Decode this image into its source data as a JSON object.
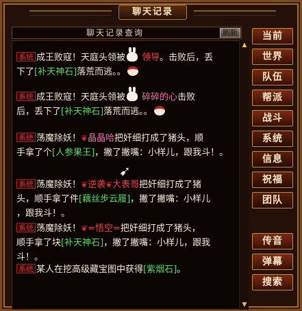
{
  "window": {
    "title": "聊天记录"
  },
  "query": {
    "label": "聊天记录查询",
    "refresh_label": "刷新"
  },
  "side_buttons": [
    "当前",
    "世界",
    "队伍",
    "帮派",
    "战斗",
    "系统",
    "信息",
    "祝福",
    "团队",
    "传音",
    "弹幕",
    "搜索"
  ],
  "messages": [
    {
      "tag": "系统",
      "line1a": "成王败寇！天庭头领被",
      "name": "领导",
      "line1b": "。击败后，丢",
      "line2a": "下了",
      "item": "[补天神石]",
      "line2b": "落荒而逃。。"
    },
    {
      "tag": "系统",
      "line1a": "成王败寇！天庭头领被",
      "name": "碎碎的心",
      "line1b": "击败",
      "line2a": "后，丢下了",
      "item": "[补天神石]",
      "line2b": "落荒而逃。。"
    },
    {
      "tag": "系统",
      "line1a": "荡魔除妖！",
      "name": "晶晶哈",
      "line1b": "把奸细打成了猪头，顺",
      "line2a": "手拿了个",
      "item": "[人参果王]",
      "line2b": "，撇了撇嘴：小样儿，跟我斗！。"
    },
    {
      "tag": "系统",
      "line1a": "荡魔除妖！",
      "name": "逆袭",
      "name2": "大表哥",
      "line1b": "把奸细打成了猪",
      "line2a": "头，顺手拿了件",
      "item": "[藕丝步云履]",
      "line2b": "，撇了撇嘴：小样儿",
      "line3": "，跟我斗！。"
    },
    {
      "tag": "系统",
      "line1a": "荡魔除妖！",
      "name": "=悟空=",
      "line1b": "把奸细打成了猪头，",
      "line2a": "顺手拿了块",
      "item": "[补天神石]",
      "line2b": "，撇了撇嘴：小样儿，跟我",
      "line3": "斗！。"
    },
    {
      "tag": "系统",
      "line1a": "某人在挖高级藏宝图中获得",
      "item": "[紫烟石]",
      "line1b": "。"
    }
  ],
  "icons": {
    "scroll_up": "double-chevron-up-icon",
    "scroll_down": "double-chevron-down-icon",
    "rose": "rose-icon",
    "bunny": "bunny-emote-icon",
    "face": "face-emote-icon",
    "cursor": "mouse-cursor-icon"
  },
  "colors": {
    "item": "#58d858",
    "player": "#f04040",
    "tag": "#e83030",
    "text": "#f2ead8",
    "accent": "#c08a40"
  }
}
